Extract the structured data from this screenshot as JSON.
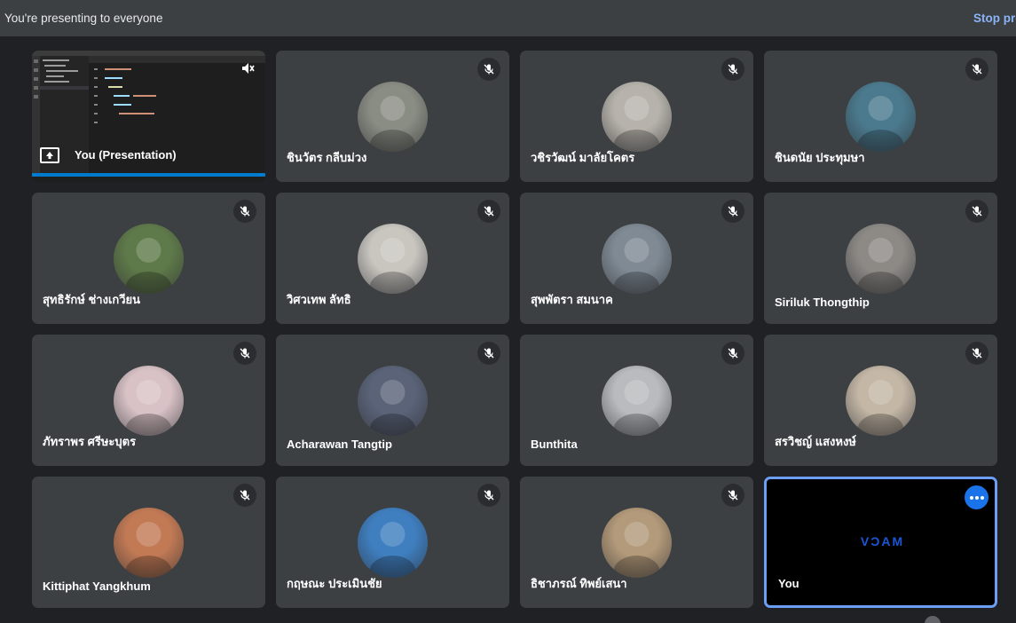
{
  "banner": {
    "message": "You're presenting to everyone",
    "stop_label": "Stop pre"
  },
  "presentation": {
    "label": "You (Presentation)",
    "icons": [
      "present-icon",
      "speaker-muted-icon"
    ]
  },
  "participants": [
    {
      "name": "ชินวัตร กลีบม่วง",
      "muted": true,
      "avatar_color": "#8a8d84"
    },
    {
      "name": "วชิรวัฒน์ มาลัยโคตร",
      "muted": true,
      "avatar_color": "#b7b3ac"
    },
    {
      "name": "ชินดนัย ประทุมษา",
      "muted": true,
      "avatar_color": "#4b7a8e"
    },
    {
      "name": "สุทธิรักษ์ ช่างเกวียน",
      "muted": true,
      "avatar_color": "#5f7a4a"
    },
    {
      "name": "วิศวเทพ ลัทธิ",
      "muted": true,
      "avatar_color": "#c9c6c0"
    },
    {
      "name": "สุพพัตรา สมนาค",
      "muted": true,
      "avatar_color": "#7f8a94"
    },
    {
      "name": "Siriluk Thongthip",
      "muted": true,
      "avatar_color": "#8d8a86"
    },
    {
      "name": "ภัทราพร ศรีษะบุตร",
      "muted": true,
      "avatar_color": "#d8c2c6"
    },
    {
      "name": "Acharawan Tangtip",
      "muted": true,
      "avatar_color": "#5a6378"
    },
    {
      "name": "Bunthita",
      "muted": true,
      "avatar_color": "#b9bbbe"
    },
    {
      "name": "สรวิชญ์ แสงหงษ์",
      "muted": true,
      "avatar_color": "#c4b7a6"
    },
    {
      "name": "Kittiphat Yangkhum",
      "muted": true,
      "avatar_color": "#c27a55"
    },
    {
      "name": "กฤษณะ ประเมินชัย",
      "muted": true,
      "avatar_color": "#3f7fc0"
    },
    {
      "name": "ธิชาภรณ์ ทิพย์เสนา",
      "muted": true,
      "avatar_color": "#b39a7a"
    }
  ],
  "self": {
    "name": "You",
    "camera_brand": "MACV",
    "icons": [
      "more-options-icon"
    ]
  },
  "colors": {
    "accent": "#8ab4f8",
    "tile_bg": "#3c4043",
    "page_bg": "#202124"
  }
}
